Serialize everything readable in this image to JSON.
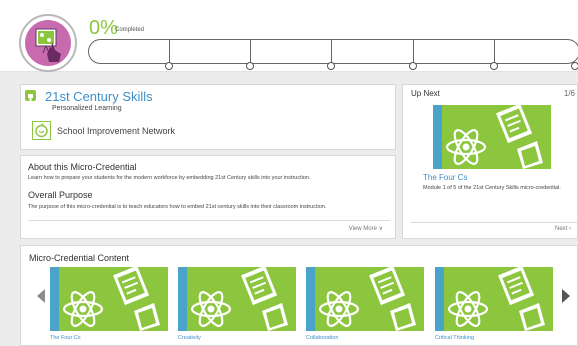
{
  "progress": {
    "percent": "0%",
    "label": "Completed",
    "milestones": 6
  },
  "credential": {
    "title": "21st Century Skills",
    "subtitle": "Personalized Learning",
    "organization": "School Improvement Network"
  },
  "about": {
    "heading": "About this Micro-Credential",
    "text": "Learn how to prepare your students for the modern workforce by embedding 21st Century skills into your instruction.",
    "purpose_heading": "Overall Purpose",
    "purpose_text": "The purpose of this micro-credential is to teach educators how to embed 21st century skills into their classroom instruction.",
    "view_more": "View More ∨"
  },
  "up_next": {
    "heading": "Up Next",
    "counter": "1/6",
    "title": "The Four Cs",
    "description": "Module 1 of 5 of the 21st Century Skills micro-credential.",
    "next_label": "Next ›"
  },
  "content": {
    "heading": "Micro-Credential Content",
    "items": [
      {
        "label": "The Four Cs"
      },
      {
        "label": "Creativity"
      },
      {
        "label": "Collaboration"
      },
      {
        "label": "Critical Thinking"
      }
    ]
  },
  "colors": {
    "accent_green": "#8cc63f",
    "link_blue": "#3e8fc9",
    "badge_pink": "#c86aae",
    "thumb_stripe": "#4aa3c9"
  }
}
